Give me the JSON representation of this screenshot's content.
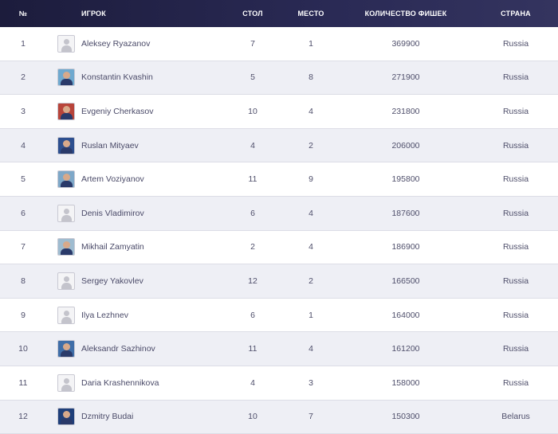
{
  "header": {
    "num": "№",
    "player": "ИГРОК",
    "table": "СТОЛ",
    "place": "МЕСТО",
    "chips": "КОЛИЧЕСТВО ФИШЕК",
    "country": "СТРАНА"
  },
  "rows": [
    {
      "num": "1",
      "name": "Aleksey Ryazanov",
      "table": "7",
      "place": "1",
      "chips": "369900",
      "country": "Russia",
      "avatar": "placeholder",
      "photo_bg": "#f4f4f6"
    },
    {
      "num": "2",
      "name": "Konstantin Kvashin",
      "table": "5",
      "place": "8",
      "chips": "271900",
      "country": "Russia",
      "avatar": "photo",
      "photo_bg": "#6fa9cf"
    },
    {
      "num": "3",
      "name": "Evgeniy Cherkasov",
      "table": "10",
      "place": "4",
      "chips": "231800",
      "country": "Russia",
      "avatar": "photo",
      "photo_bg": "#b8443a"
    },
    {
      "num": "4",
      "name": "Ruslan Mityaev",
      "table": "4",
      "place": "2",
      "chips": "206000",
      "country": "Russia",
      "avatar": "photo",
      "photo_bg": "#2d4f8f"
    },
    {
      "num": "5",
      "name": "Artem Voziyanov",
      "table": "11",
      "place": "9",
      "chips": "195800",
      "country": "Russia",
      "avatar": "photo",
      "photo_bg": "#7ea8c8"
    },
    {
      "num": "6",
      "name": "Denis Vladimirov",
      "table": "6",
      "place": "4",
      "chips": "187600",
      "country": "Russia",
      "avatar": "placeholder",
      "photo_bg": "#f4f4f6"
    },
    {
      "num": "7",
      "name": "Mikhail Zamyatin",
      "table": "2",
      "place": "4",
      "chips": "186900",
      "country": "Russia",
      "avatar": "photo",
      "photo_bg": "#9fbcd0"
    },
    {
      "num": "8",
      "name": "Sergey Yakovlev",
      "table": "12",
      "place": "2",
      "chips": "166500",
      "country": "Russia",
      "avatar": "placeholder",
      "photo_bg": "#f4f4f6"
    },
    {
      "num": "9",
      "name": "Ilya Lezhnev",
      "table": "6",
      "place": "1",
      "chips": "164000",
      "country": "Russia",
      "avatar": "placeholder",
      "photo_bg": "#f4f4f6"
    },
    {
      "num": "10",
      "name": "Aleksandr Sazhinov",
      "table": "11",
      "place": "4",
      "chips": "161200",
      "country": "Russia",
      "avatar": "photo",
      "photo_bg": "#3f6ea8"
    },
    {
      "num": "11",
      "name": "Daria Krashennikova",
      "table": "4",
      "place": "3",
      "chips": "158000",
      "country": "Russia",
      "avatar": "placeholder",
      "photo_bg": "#f4f4f6"
    },
    {
      "num": "12",
      "name": "Dzmitry Budai",
      "table": "10",
      "place": "7",
      "chips": "150300",
      "country": "Belarus",
      "avatar": "photo",
      "photo_bg": "#1f3f7a"
    }
  ]
}
